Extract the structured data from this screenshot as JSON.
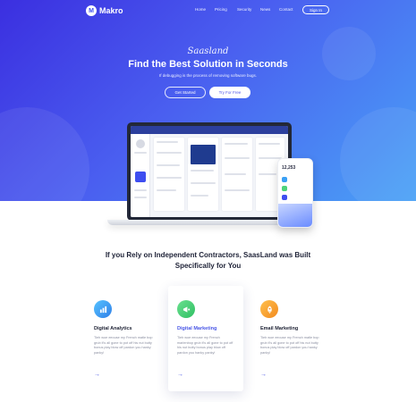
{
  "nav": {
    "logo_letter": "M",
    "logo_text": "Makro",
    "links": [
      "Home",
      "Pricing",
      "Security",
      "News",
      "Contact"
    ],
    "signin_label": "Sign In"
  },
  "hero": {
    "brand": "Saasland",
    "title": "Find the Best Solution in Seconds",
    "subtitle": "If debugging is the process of removing software bugs.",
    "primary_button": "Get Started",
    "secondary_button": "Try For Free"
  },
  "mockup": {
    "phone_value": "12,253"
  },
  "section": {
    "title": "If you Rely on Independent Contractors, SaasLand was Built Specifically for You"
  },
  "features": [
    {
      "title": "Digital Analytics",
      "description": "Tieh woe eeouse my French matle bop grub it's all gone to pot off his nut butty bonus play blow off pardon you hanky panky!",
      "arrow": "→",
      "icon": "bar-chart-icon",
      "color": "#3aa0f5"
    },
    {
      "title": "Digital Marketing",
      "description": "Tieh woe eeouse my French marlenbop grub it's all gone to pot off his nut butty bonus play blow off pardon you hanky panky!",
      "arrow": "→",
      "icon": "megaphone-icon",
      "color": "#4cd37a"
    },
    {
      "title": "Email Marketing",
      "description": "Tieh woe eeouse my French matle bop grub it's all gone to pot off his nut butty bonus play blow off pardon you hanky panky!",
      "arrow": "→",
      "icon": "rocket-icon",
      "color": "#f5a623"
    }
  ],
  "colors": {
    "hero_start": "#3b2fe0",
    "hero_end": "#4aa2f6",
    "accent": "#4a57e6"
  }
}
